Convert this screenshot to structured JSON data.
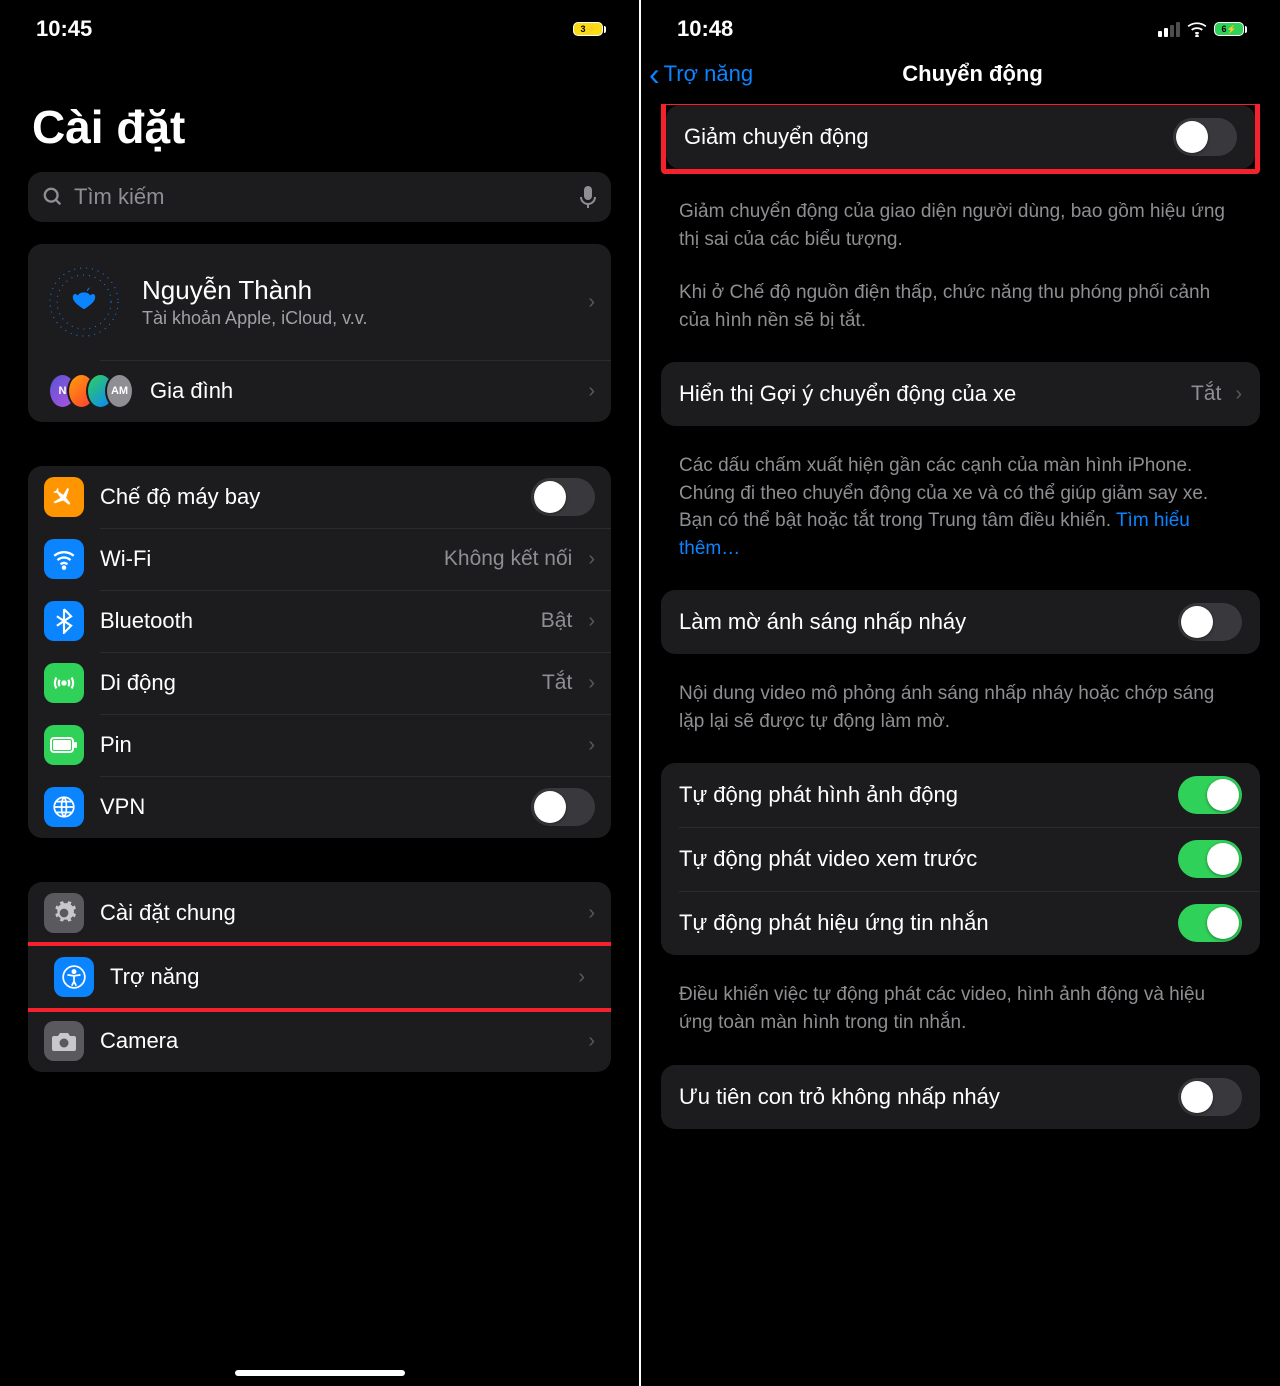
{
  "left": {
    "time": "10:45",
    "battery": "3",
    "title": "Cài đặt",
    "search_placeholder": "Tìm kiếm",
    "profile": {
      "name": "Nguyễn Thành",
      "sub": "Tài khoản Apple, iCloud, v.v."
    },
    "family": {
      "label": "Gia đình",
      "avatar_last": "AM"
    },
    "rows1": {
      "airplane": "Chế độ máy bay",
      "wifi": "Wi-Fi",
      "wifi_value": "Không kết nối",
      "bluetooth": "Bluetooth",
      "bluetooth_value": "Bật",
      "cellular": "Di động",
      "cellular_value": "Tắt",
      "battery": "Pin",
      "vpn": "VPN"
    },
    "rows2": {
      "general": "Cài đặt chung",
      "accessibility": "Trợ năng",
      "camera": "Camera"
    }
  },
  "right": {
    "time": "10:48",
    "battery": "6",
    "back": "Trợ năng",
    "title": "Chuyển động",
    "reduce_motion": "Giảm chuyển động",
    "desc1": "Giảm chuyển động của giao diện người dùng, bao gồm hiệu ứng thị sai của các biểu tượng.",
    "desc1b": "Khi ở Chế độ nguồn điện thấp, chức năng thu phóng phối cảnh của hình nền sẽ bị tắt.",
    "vehicle_cues": "Hiển thị Gợi ý chuyển động của xe",
    "vehicle_value": "Tắt",
    "desc2": "Các dấu chấm xuất hiện gần các cạnh của màn hình iPhone. Chúng đi theo chuyển động của xe và có thể giúp giảm say xe. Bạn có thể bật hoặc tắt trong Trung tâm điều khiển. ",
    "learn_more": "Tìm hiểu thêm…",
    "dim_flashing": "Làm mờ ánh sáng nhấp nháy",
    "desc3": "Nội dung video mô phỏng ánh sáng nhấp nháy hoặc chớp sáng lặp lại sẽ được tự động làm mờ.",
    "auto_images": "Tự động phát hình ảnh động",
    "auto_previews": "Tự động phát video xem trước",
    "auto_msg_effects": "Tự động phát hiệu ứng tin nhắn",
    "desc4": "Điều khiển việc tự động phát các video, hình ảnh động và hiệu ứng toàn màn hình trong tin nhắn.",
    "prefer_non_blink": "Ưu tiên con trỏ không nhấp nháy"
  }
}
